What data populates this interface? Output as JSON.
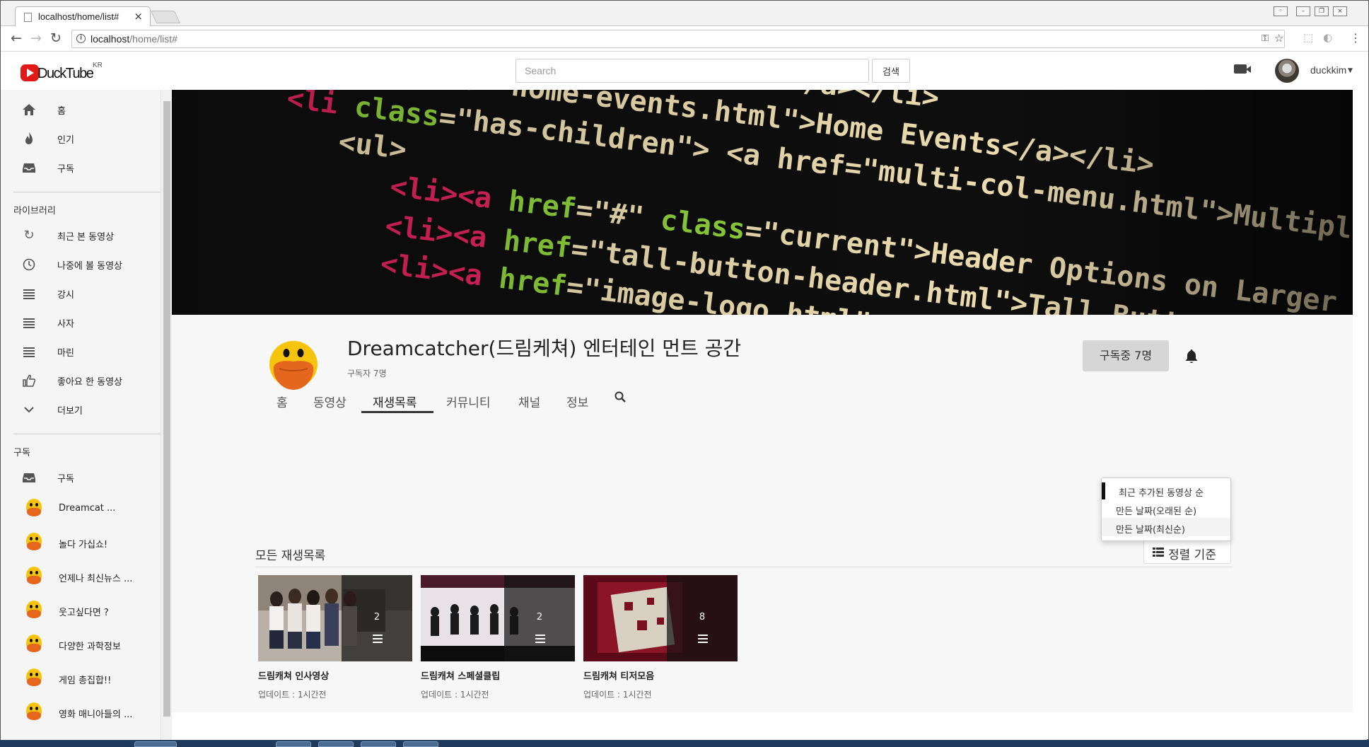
{
  "browser": {
    "tab_title": "localhost/home/list#",
    "tab_close": "×",
    "url_host": "localhost",
    "url_path": "/home/list#"
  },
  "header": {
    "logo_text": "DuckTube",
    "logo_region": "KR",
    "search_placeholder": "Search",
    "search_button": "검색",
    "username": "duckkim"
  },
  "sidebar": {
    "main_items": [
      {
        "label": "홈",
        "icon": "home-icon"
      },
      {
        "label": "인기",
        "icon": "fire-icon"
      },
      {
        "label": "구독",
        "icon": "inbox-icon"
      }
    ],
    "library_title": "라이브러리",
    "library_items": [
      {
        "label": "최근 본 동영상",
        "icon": "refresh-icon"
      },
      {
        "label": "나중에 볼 동영상",
        "icon": "clock-icon"
      },
      {
        "label": "강시",
        "icon": "list-icon"
      },
      {
        "label": "사자",
        "icon": "list-icon"
      },
      {
        "label": "마린",
        "icon": "list-icon"
      },
      {
        "label": "좋아요 한 동영상",
        "icon": "thumbs-up-icon"
      },
      {
        "label": "더보기",
        "icon": "chevron-down-icon"
      }
    ],
    "subscriptions_title": "구독",
    "subscriptions_header_item": "구독",
    "channels": [
      "Dreamcat ...",
      "놀다 가십쇼!",
      "언제나 최신뉴스 ...",
      "웃고싶다면 ?",
      "다양한 과학정보",
      "게임 총집합!!",
      "영화 매니아들의 ..."
    ]
  },
  "channel": {
    "title": "Dreamcatcher(드림케쳐) 엔터테인 먼트 공간",
    "subscribers": "구독자 7명",
    "subscribe_button": "구독중 7명",
    "tabs": [
      "홈",
      "동영상",
      "재생목록",
      "커뮤니티",
      "채널",
      "정보"
    ],
    "active_tab": "재생목록"
  },
  "playlists": {
    "section_title": "모든 재생목록",
    "sort_button": "정렬 기준",
    "sort_options": [
      "최근 추가된 동영상 순",
      "만든 날짜(오래된 순)",
      "만든 날짜(최신순)"
    ],
    "items": [
      {
        "title": "드림캐쳐 인사영상",
        "count": "2",
        "updated": "업데이트 : 1시간전"
      },
      {
        "title": "드림캐쳐 스페셜클립",
        "count": "2",
        "updated": "업데이트 : 1시간전"
      },
      {
        "title": "드림캐쳐 티저모음",
        "count": "8",
        "updated": "업데이트 : 1시간전"
      }
    ]
  },
  "banner_code": [
    "<li><a href=\"index.html\">Home</a></li>",
    "<li><a href=\"home-events.html\">Home Events</a></li>",
    "<li class=\"has-children\"><a href=\"multi-col-menu.html\">Multiple Column Menu</a>",
    "<ul>",
    "<li><a href=\"#\" class=\"current\">Header Options on Larger Viewports</a></li>",
    "<li><a href=\"tall-button-header.html\">Tall Button Header</a></li>",
    "<li><a href=\"image-logo.html\">Image Logo</a></li>"
  ],
  "colors": {
    "brand_red": "#e01919",
    "duck_yellow": "#f6c40c",
    "duck_beak": "#e5661d",
    "code_tag": "#e0245e",
    "code_attr": "#8ed13a",
    "code_string": "#ecdcb0"
  }
}
